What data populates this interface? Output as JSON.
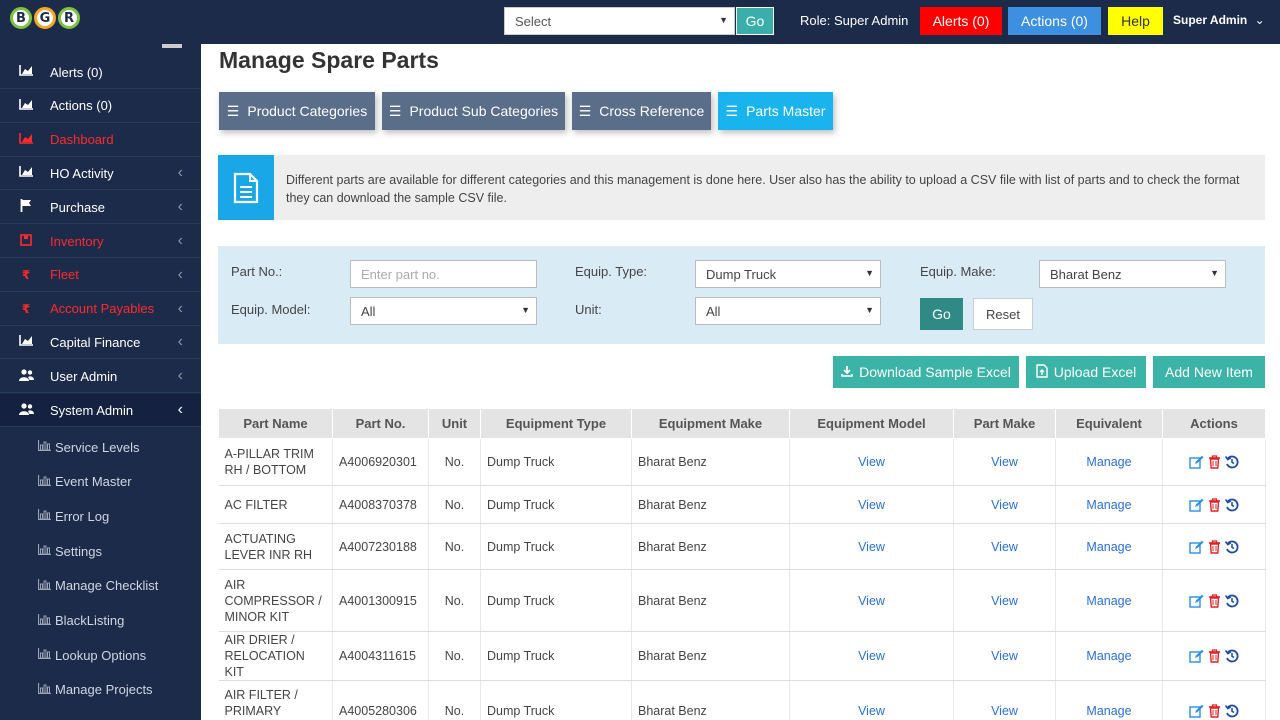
{
  "header": {
    "logo_letters": [
      "B",
      "G",
      "R"
    ],
    "select_value": "Select",
    "go_label": "Go",
    "role_text": "Role: Super Admin",
    "alerts_label": "Alerts (0)",
    "actions_label": "Actions (0)",
    "help_label": "Help",
    "user_label": "Super Admin",
    "colors": {
      "alerts": "#ff0000",
      "actions": "#3d8fe0",
      "help": "#ffff00"
    }
  },
  "sidebar": {
    "items": [
      {
        "label": "Alerts (0)",
        "icon": "chart-icon",
        "chevron": false,
        "red": false
      },
      {
        "label": "Actions (0)",
        "icon": "chart-icon",
        "chevron": false,
        "red": false
      },
      {
        "label": "Dashboard",
        "icon": "chart-icon",
        "chevron": false,
        "red": true
      },
      {
        "label": "HO Activity",
        "icon": "chart-icon",
        "chevron": true,
        "red": false
      },
      {
        "label": "Purchase",
        "icon": "flag-icon",
        "chevron": true,
        "red": false
      },
      {
        "label": "Inventory",
        "icon": "box-icon",
        "chevron": true,
        "red": true
      },
      {
        "label": "Fleet",
        "icon": "rupee-icon",
        "chevron": true,
        "red": true
      },
      {
        "label": "Account Payables",
        "icon": "rupee-icon",
        "chevron": true,
        "red": true
      },
      {
        "label": "Capital Finance",
        "icon": "chart-icon",
        "chevron": true,
        "red": false
      },
      {
        "label": "User Admin",
        "icon": "users-icon",
        "chevron": true,
        "red": false
      },
      {
        "label": "System Admin",
        "icon": "users-icon",
        "chevron": true,
        "red": false,
        "active": true
      }
    ],
    "subitems": [
      "Service Levels",
      "Event Master",
      "Error Log",
      "Settings",
      "Manage Checklist",
      "BlackListing",
      "Lookup Options",
      "Manage Projects"
    ]
  },
  "page": {
    "title": "Manage Spare Parts",
    "tabs": [
      "Product Categories",
      "Product Sub Categories",
      "Cross Reference",
      "Parts Master"
    ],
    "info_text": "Different parts are available for different categories and this management is done here. User also has the ability to upload a CSV file with list of parts and to check the format they can download the sample CSV file."
  },
  "filters": {
    "part_no_label": "Part No.:",
    "part_no_placeholder": "Enter part no.",
    "equip_type_label": "Equip. Type:",
    "equip_type_value": "Dump Truck",
    "equip_make_label": "Equip. Make:",
    "equip_make_value": "Bharat Benz",
    "equip_model_label": "Equip. Model:",
    "equip_model_value": "All",
    "unit_label": "Unit:",
    "unit_value": "All",
    "go_label": "Go",
    "reset_label": "Reset"
  },
  "actions": {
    "download_label": "Download Sample Excel",
    "upload_label": "Upload Excel",
    "add_label": "Add New Item"
  },
  "table": {
    "headers": [
      "Part Name",
      "Part No.",
      "Unit",
      "Equipment Type",
      "Equipment Make",
      "Equipment Model",
      "Part Make",
      "Equivalent",
      "Actions"
    ],
    "rows": [
      {
        "name": "A-PILLAR TRIM RH / BOTTOM",
        "no": "A4006920301",
        "unit": "No.",
        "type": "Dump Truck",
        "make": "Bharat Benz",
        "model": "View",
        "part_make": "View",
        "equivalent": "Manage"
      },
      {
        "name": "AC FILTER",
        "no": "A4008370378",
        "unit": "No.",
        "type": "Dump Truck",
        "make": "Bharat Benz",
        "model": "View",
        "part_make": "View",
        "equivalent": "Manage"
      },
      {
        "name": "ACTUATING LEVER INR RH",
        "no": "A4007230188",
        "unit": "No.",
        "type": "Dump Truck",
        "make": "Bharat Benz",
        "model": "View",
        "part_make": "View",
        "equivalent": "Manage"
      },
      {
        "name": "AIR COMPRESSOR / MINOR KIT",
        "no": "A4001300915",
        "unit": "No.",
        "type": "Dump Truck",
        "make": "Bharat Benz",
        "model": "View",
        "part_make": "View",
        "equivalent": "Manage"
      },
      {
        "name": "AIR DRIER / RELOCATION KIT",
        "no": "A4004311615",
        "unit": "No.",
        "type": "Dump Truck",
        "make": "Bharat Benz",
        "model": "View",
        "part_make": "View",
        "equivalent": "Manage"
      },
      {
        "name": "AIR FILTER / PRIMARY ELEMENT",
        "no": "A4005280306",
        "unit": "No.",
        "type": "Dump Truck",
        "make": "Bharat Benz",
        "model": "View",
        "part_make": "View",
        "equivalent": "Manage"
      }
    ]
  }
}
